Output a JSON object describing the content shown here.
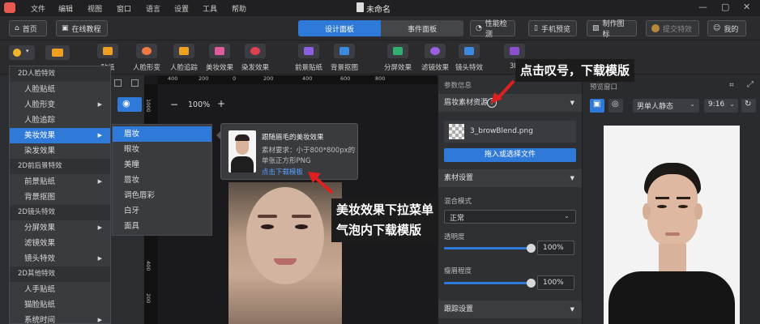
{
  "menubar": {
    "items": [
      "文件",
      "编辑",
      "视图",
      "窗口",
      "语言",
      "设置",
      "工具",
      "帮助"
    ],
    "doc_title": "未命名"
  },
  "toolbar": {
    "home": "首页",
    "tutorial": "在线教程",
    "tab_design": "设计面板",
    "tab_event": "事件面板",
    "perf_check": "性能检测",
    "phone_preview": "手机预览",
    "make_icon": "制作图标",
    "submit": "提交特效",
    "mine": "我的"
  },
  "featbar": {
    "items": [
      "贴纸",
      "人脸形变",
      "人脸追踪",
      "美妆效果",
      "染发效果",
      "前景贴纸",
      "背景抠图",
      "分屏效果",
      "滤镜效果",
      "镜头特效",
      "3D"
    ]
  },
  "leftmenu": {
    "rows": [
      {
        "label": "2D人脸特效",
        "type": "head"
      },
      {
        "label": "人脸贴纸",
        "type": "item"
      },
      {
        "label": "人脸形变",
        "type": "item",
        "arrow": true
      },
      {
        "label": "人脸追踪",
        "type": "item"
      },
      {
        "label": "美妆效果",
        "type": "sel",
        "arrow": true
      },
      {
        "label": "染发效果",
        "type": "item"
      },
      {
        "label": "2D前后景特效",
        "type": "head"
      },
      {
        "label": "前景贴纸",
        "type": "item",
        "arrow": true
      },
      {
        "label": "背景抠图",
        "type": "item"
      },
      {
        "label": "2D镜头特效",
        "type": "head"
      },
      {
        "label": "分屏效果",
        "type": "item",
        "arrow": true
      },
      {
        "label": "滤镜效果",
        "type": "item"
      },
      {
        "label": "镜头特效",
        "type": "item",
        "arrow": true
      },
      {
        "label": "2D其他特效",
        "type": "head"
      },
      {
        "label": "人手贴纸",
        "type": "item"
      },
      {
        "label": "猫脸贴纸",
        "type": "item"
      },
      {
        "label": "系统时间",
        "type": "item",
        "arrow": true
      }
    ]
  },
  "submenu": {
    "items": [
      "眉妆",
      "眼妆",
      "美瞳",
      "唇妆",
      "调色唇彩",
      "白牙",
      "面具"
    ],
    "selected_index": 0
  },
  "tooltip": {
    "title": "跟随眉毛的美妆效果",
    "req1": "素材要求：小于800*800px的",
    "req2": "单张正方形PNG",
    "link": "点击下载模板"
  },
  "canvas": {
    "zoom": "100%",
    "ruler_h": [
      "400",
      "200",
      "0",
      "200",
      "400",
      "600",
      "800"
    ],
    "ruler_v": [
      "1000",
      "800",
      "600",
      "400",
      "200"
    ]
  },
  "rightpanel": {
    "section_params": "参数信息",
    "section_resource": "眉妆素材资源",
    "file_name": "3_browBlend.png",
    "upload_btn": "拖入或选择文件",
    "section_settings": "素材设置",
    "blend_label": "混合模式",
    "blend_value": "正常",
    "opacity_label": "透明度",
    "opacity_value": "100%",
    "opacity_fraction": 1.0,
    "fade_label": "瘦眉程度",
    "fade_value": "100%",
    "fade_fraction": 1.0,
    "section_track": "跟踪设置"
  },
  "preview": {
    "title": "预览窗口",
    "model": "男单人静态",
    "ratio": "9:16"
  },
  "annotations": {
    "top": "点击叹号，下载模版",
    "mid1": "美妆效果下拉菜单",
    "mid2": "气泡内下载模版"
  },
  "colors": {
    "accent": "#2f7ad8",
    "arrow": "#e02020"
  }
}
